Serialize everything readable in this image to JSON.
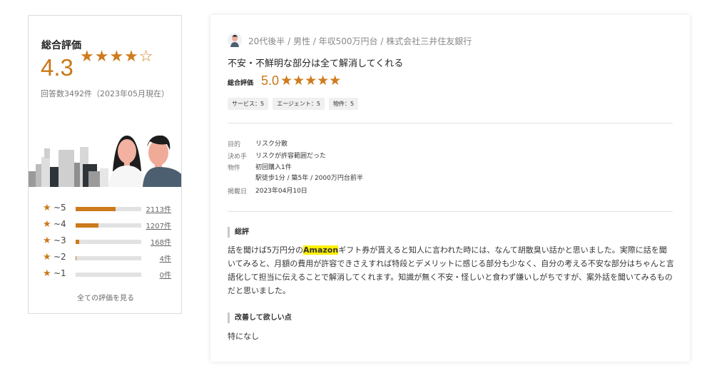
{
  "summary": {
    "title": "総合評価",
    "score": "4.3",
    "stars": "★★★★☆",
    "count_text": "回答数3492件（2023年05月現在）",
    "distribution": [
      {
        "label": "~5",
        "count": "2113件",
        "fraction": 0.61
      },
      {
        "label": "~4",
        "count": "1207件",
        "fraction": 0.35
      },
      {
        "label": "~3",
        "count": "168件",
        "fraction": 0.05
      },
      {
        "label": "~2",
        "count": "4件",
        "fraction": 0.01
      },
      {
        "label": "~1",
        "count": "0件",
        "fraction": 0.0
      }
    ],
    "view_all": "全ての評価を見る"
  },
  "review": {
    "meta": "20代後半 / 男性 / 年収500万円台 / 株式会社三井住友銀行",
    "title": "不安・不鮮明な部分は全て解消してくれる",
    "rating_label": "総合評価",
    "rating_score": "5.0",
    "rating_stars": "★★★★★",
    "tags": [
      "サービス：5",
      "エージェント：5",
      "物件：5"
    ],
    "details": [
      {
        "key": "目的",
        "value": "リスク分散"
      },
      {
        "key": "決め手",
        "value": "リスクが許容範囲だった"
      },
      {
        "key": "物件",
        "value": "初回購入1件",
        "value2": "駅徒歩1分 / 築5年 / 2000万円台前半"
      },
      {
        "key": "掲載日",
        "value": "2023年04月10日"
      }
    ],
    "overall_heading": "総評",
    "overall_before": "話を聞けば5万円分の",
    "overall_highlight": "Amazon",
    "overall_after": "ギフト券が貰えると知人に言われた時には、なんて胡散臭い話かと思いました。実際に話を聞いてみると、月額の費用が許容できさえすれば特段とデメリットに感じる部分も少なく、自分の考える不安な部分はちゃんと言語化して担当に伝えることで解消してくれます。知識が無く不安・怪しいと食わず嫌いしがちですが、案外話を聞いてみるものだと思いました。",
    "improve_heading": "改善して欲しい点",
    "improve_text": "特になし"
  },
  "colors": {
    "accent": "#cc7a1c",
    "track": "#e2e2e2",
    "highlight": "#fff000"
  }
}
